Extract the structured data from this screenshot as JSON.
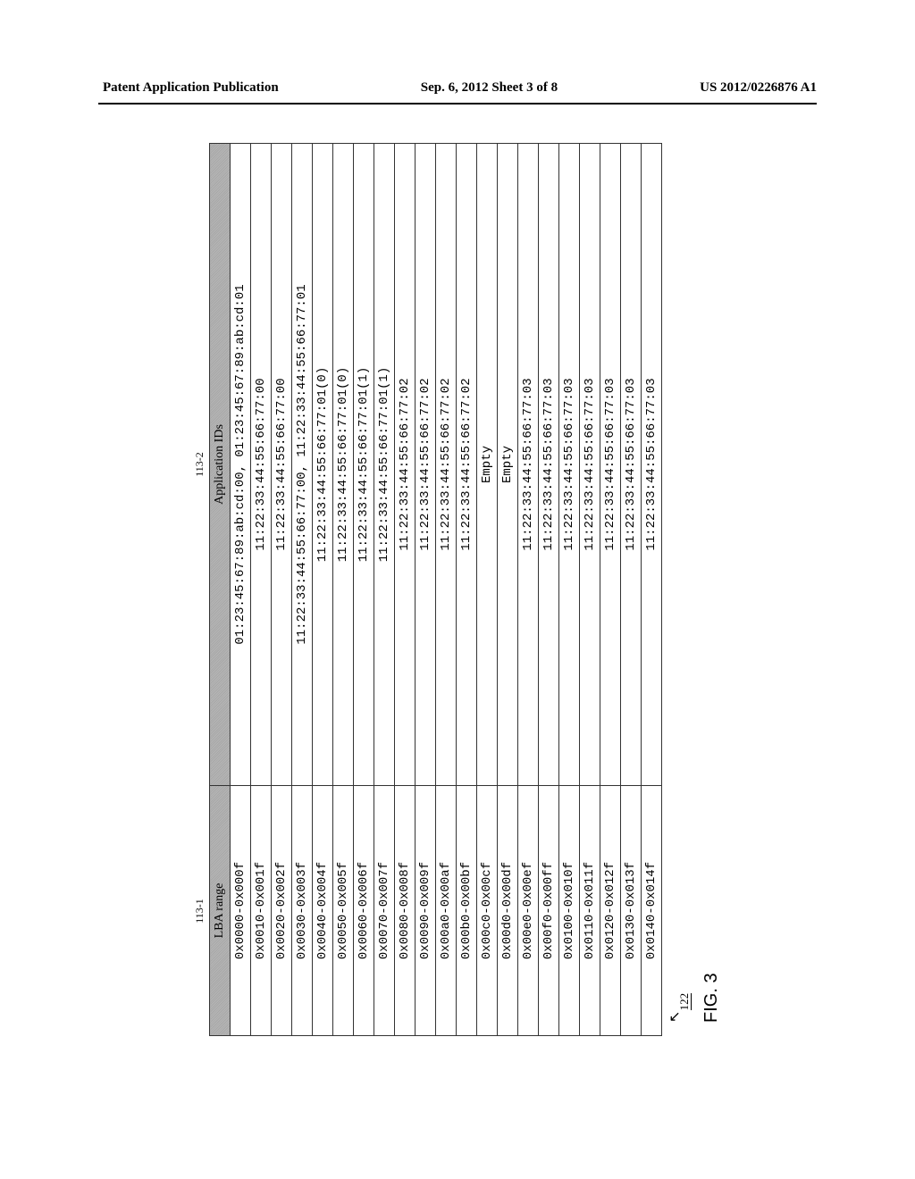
{
  "header": {
    "left": "Patent Application Publication",
    "center": "Sep. 6, 2012  Sheet 3 of 8",
    "right": "US 2012/0226876 A1"
  },
  "column_refs": {
    "left": "113-1",
    "right": "113-2"
  },
  "table": {
    "headers": {
      "lba": "LBA range",
      "app": "Application IDs"
    },
    "rows": [
      {
        "lba": "0x0000-0x000f",
        "app": "01:23:45:67:89:ab:cd:00, 01:23:45:67:89:ab:cd:01"
      },
      {
        "lba": "0x0010-0x001f",
        "app": "11:22:33:44:55:66:77:00"
      },
      {
        "lba": "0x0020-0x002f",
        "app": "11:22:33:44:55:66:77:00"
      },
      {
        "lba": "0x0030-0x003f",
        "app": "11:22:33:44:55:66:77:00, 11:22:33:44:55:66:77:01"
      },
      {
        "lba": "0x0040-0x004f",
        "app": "11:22:33:44:55:66:77:01(0)"
      },
      {
        "lba": "0x0050-0x005f",
        "app": "11:22:33:44:55:66:77:01(0)"
      },
      {
        "lba": "0x0060-0x006f",
        "app": "11:22:33:44:55:66:77:01(1)"
      },
      {
        "lba": "0x0070-0x007f",
        "app": "11:22:33:44:55:66:77:01(1)"
      },
      {
        "lba": "0x0080-0x008f",
        "app": "11:22:33:44:55:66:77:02"
      },
      {
        "lba": "0x0090-0x009f",
        "app": "11:22:33:44:55:66:77:02"
      },
      {
        "lba": "0x00a0-0x00af",
        "app": "11:22:33:44:55:66:77:02"
      },
      {
        "lba": "0x00b0-0x00bf",
        "app": "11:22:33:44:55:66:77:02"
      },
      {
        "lba": "0x00c0-0x00cf",
        "app": "Empty"
      },
      {
        "lba": "0x00d0-0x00df",
        "app": "Empty"
      },
      {
        "lba": "0x00e0-0x00ef",
        "app": "11:22:33:44:55:66:77:03"
      },
      {
        "lba": "0x00f0-0x00ff",
        "app": "11:22:33:44:55:66:77:03"
      },
      {
        "lba": "0x0100-0x010f",
        "app": "11:22:33:44:55:66:77:03"
      },
      {
        "lba": "0x0110-0x011f",
        "app": "11:22:33:44:55:66:77:03"
      },
      {
        "lba": "0x0120-0x012f",
        "app": "11:22:33:44:55:66:77:03"
      },
      {
        "lba": "0x0130-0x013f",
        "app": "11:22:33:44:55:66:77:03"
      },
      {
        "lba": "0x0140-0x014f",
        "app": "11:22:33:44:55:66:77:03"
      }
    ]
  },
  "annotation": {
    "ref": "122"
  },
  "figure_label": "FIG. 3"
}
